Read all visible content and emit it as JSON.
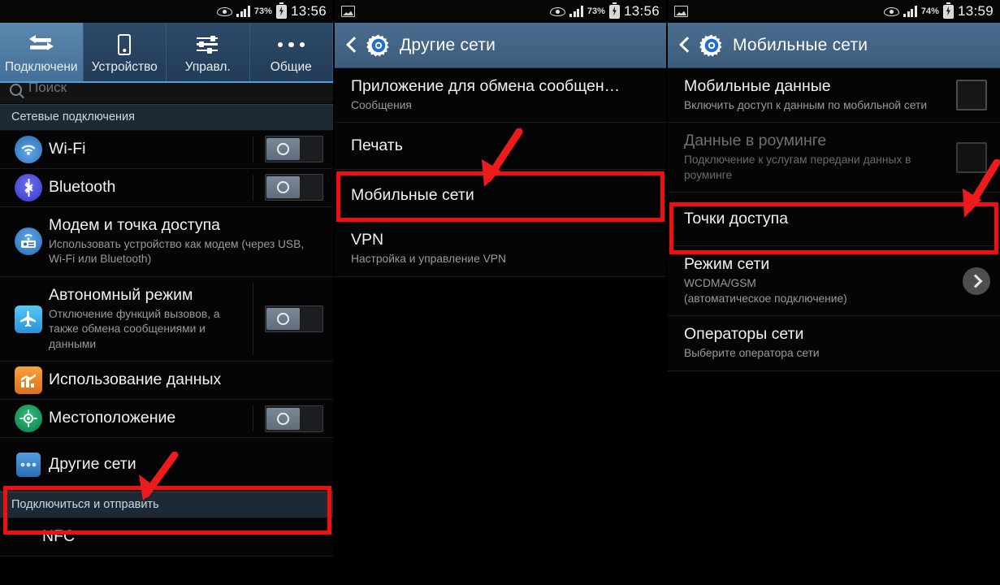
{
  "panels": [
    {
      "id": "connections",
      "statusbar": {
        "battery_pct": "73%",
        "time": "13:56",
        "eye_icon": "eye-icon",
        "signal_icon": "signal-bars-icon",
        "battery_icon": "battery-charging-icon"
      },
      "tabs": [
        {
          "label": "Подключени",
          "icon": "transfer-arrows-icon",
          "active": true
        },
        {
          "label": "Устройство",
          "icon": "phone-icon",
          "active": false
        },
        {
          "label": "Управл.",
          "icon": "sliders-icon",
          "active": false
        },
        {
          "label": "Общие",
          "icon": "three-dots-icon",
          "active": false
        }
      ],
      "search": {
        "placeholder": "Поиск",
        "icon": "search-icon"
      },
      "sections": [
        {
          "header": "Сетевые подключения",
          "items": [
            {
              "title": "Wi-Fi",
              "subtitle": "",
              "icon": "wifi-icon",
              "control": "toggle",
              "toggle_on": false
            },
            {
              "title": "Bluetooth",
              "subtitle": "",
              "icon": "bluetooth-icon",
              "control": "toggle",
              "toggle_on": false
            },
            {
              "title": "Модем и точка доступа",
              "subtitle": "Использовать устройство как модем (через USB, Wi-Fi или Bluetooth)",
              "icon": "hotspot-icon",
              "control": "none"
            },
            {
              "title": "Автономный режим",
              "subtitle": "Отключение функций вызовов, а также обмена сообщениями и данными",
              "icon": "airplane-icon",
              "control": "toggle",
              "toggle_on": false
            },
            {
              "title": "Использование данных",
              "subtitle": "",
              "icon": "data-usage-icon",
              "control": "none"
            },
            {
              "title": "Местоположение",
              "subtitle": "",
              "icon": "location-icon",
              "control": "toggle",
              "toggle_on": false
            },
            {
              "title": "Другие сети",
              "subtitle": "",
              "icon": "more-networks-icon",
              "control": "none",
              "highlighted": true
            }
          ]
        },
        {
          "header": "Подключиться и отправить",
          "items": [
            {
              "title": "NFC",
              "subtitle": "",
              "icon": "",
              "control": "none"
            }
          ]
        }
      ]
    },
    {
      "id": "other-networks",
      "statusbar": {
        "battery_pct": "73%",
        "time": "13:56",
        "screenshot_icon": "image-icon",
        "eye_icon": "eye-icon",
        "signal_icon": "signal-bars-icon",
        "battery_icon": "battery-charging-icon"
      },
      "actionbar": {
        "title": "Другие сети",
        "back_icon": "back-chevron-icon",
        "app_icon": "settings-gear-icon"
      },
      "items": [
        {
          "title": "Приложение для обмена сообщен…",
          "subtitle": "Сообщения"
        },
        {
          "title": "Печать",
          "subtitle": ""
        },
        {
          "title": "Мобильные сети",
          "subtitle": "",
          "highlighted": true
        },
        {
          "title": "VPN",
          "subtitle": "Настройка и управление VPN"
        }
      ]
    },
    {
      "id": "mobile-networks",
      "statusbar": {
        "battery_pct": "74%",
        "time": "13:59",
        "screenshot_icon": "image-icon",
        "eye_icon": "eye-icon",
        "signal_icon": "signal-bars-icon",
        "battery_icon": "battery-charging-icon"
      },
      "actionbar": {
        "title": "Мобильные сети",
        "back_icon": "back-chevron-icon",
        "app_icon": "settings-gear-icon"
      },
      "items": [
        {
          "title": "Мобильные данные",
          "subtitle": "Включить доступ к данным по мобильной сети",
          "control": "checkbox",
          "checked": false,
          "disabled": false
        },
        {
          "title": "Данные в роуминге",
          "subtitle": "Подключение к услугам передани данных в роуминге",
          "control": "checkbox",
          "checked": false,
          "disabled": true
        },
        {
          "title": "Точки доступа",
          "subtitle": "",
          "control": "none",
          "highlighted": true
        },
        {
          "title": "Режим сети",
          "subtitle": "WCDMA/GSM\n(автоматическое подключение)",
          "control": "chevron"
        },
        {
          "title": "Операторы сети",
          "subtitle": "Выберите оператора сети",
          "control": "none"
        }
      ]
    }
  ],
  "annotation": {
    "highlight_color": "#ef1111",
    "arrow_color": "#ec1c1c",
    "arrows": [
      "arrow-to-other-networks",
      "arrow-to-mobile-networks",
      "arrow-to-access-points"
    ]
  }
}
